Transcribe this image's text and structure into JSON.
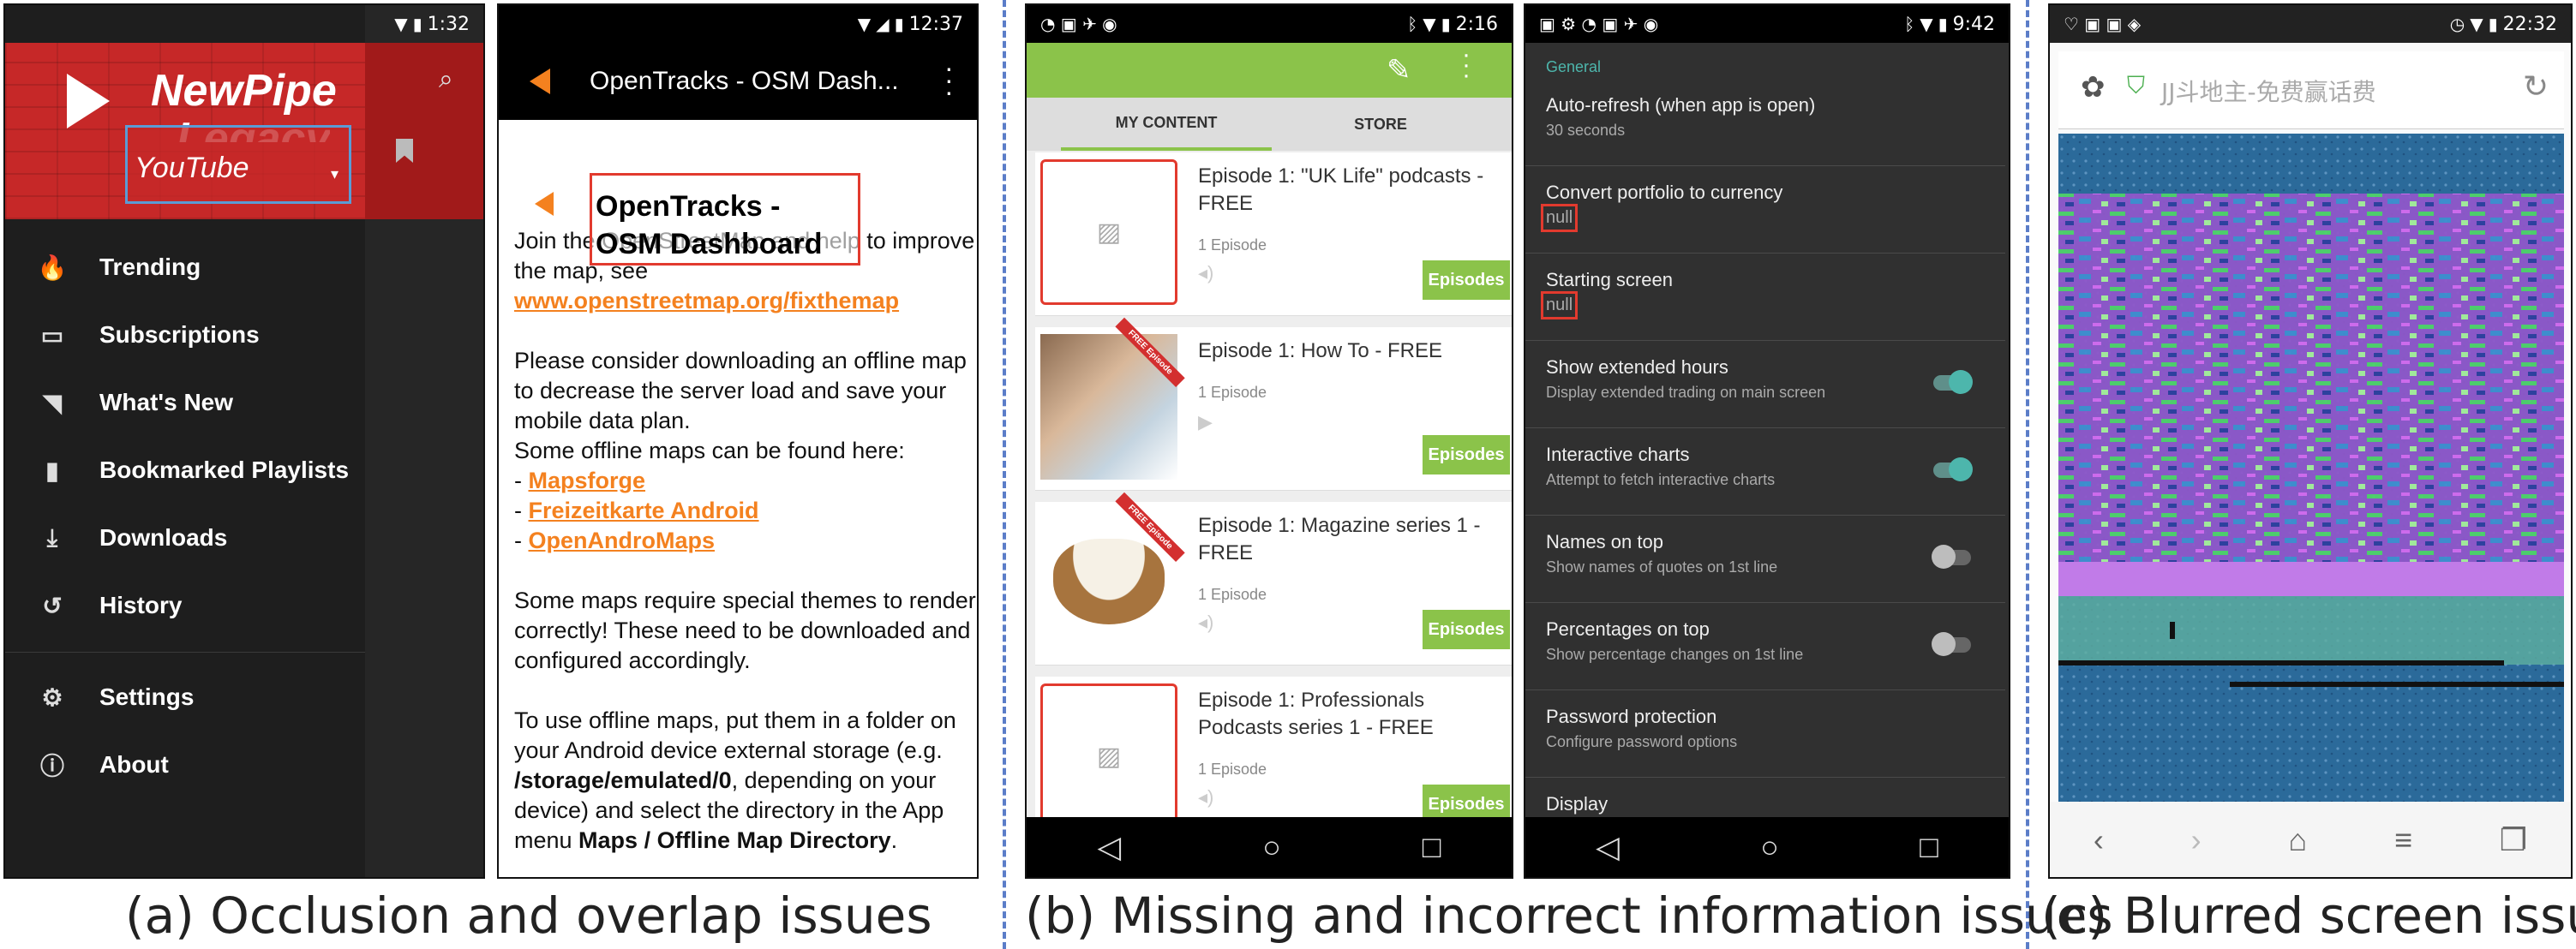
{
  "captions": {
    "a": "(a) Occlusion and overlap issues",
    "b": "(b) Missing and incorrect information issues",
    "c": "(c) Blurred screen issues"
  },
  "newpipe": {
    "time": "1:32",
    "app_name_line1": "NewPipe",
    "app_name_line2": "Legacy",
    "service": "YouTube",
    "menu": [
      {
        "icon": "fire-icon",
        "label": "Trending"
      },
      {
        "icon": "tv-icon",
        "label": "Subscriptions"
      },
      {
        "icon": "rss-icon",
        "label": "What's New"
      },
      {
        "icon": "bookmark-icon",
        "label": "Bookmarked Playlists"
      },
      {
        "icon": "download-icon",
        "label": "Downloads"
      },
      {
        "icon": "history-icon",
        "label": "History"
      },
      {
        "icon": "gear-icon",
        "label": "Settings"
      },
      {
        "icon": "info-icon",
        "label": "About"
      }
    ]
  },
  "opentracks": {
    "time": "12:37",
    "toolbar_title": "OpenTracks - OSM Dash...",
    "dialog_title": "OpenTracks - OSM Dashboard",
    "p1_prefix": "Join the OpenStreetMap and help to improve the map, see ",
    "p1_link": "www.openstreetmap.org/fixthemap",
    "p2": "Please consider downloading an offline map to decrease the server load and save your mobile data plan.",
    "p3": "Some offline maps can be found here:",
    "links": [
      "Mapsforge",
      "Freizeitkarte Android",
      "OpenAndroMaps"
    ],
    "p4": "Some maps require special themes to render correctly! These need to be downloaded and configured accordingly.",
    "p5_a": "To use offline maps, put them in a folder on your Android device external storage (e.g. ",
    "p5_b": "/storage/emulated/0",
    "p5_c": ", depending on your device) and select the directory in the App menu ",
    "p5_d": "Maps / Offline Map Directory",
    "p5_e": "."
  },
  "podcast": {
    "time": "2:16",
    "tabs": [
      "MY CONTENT",
      "STORE"
    ],
    "episodes_label": "Episodes",
    "items": [
      {
        "title": "Episode 1: \"UK Life\" podcasts - FREE",
        "count": "1 Episode",
        "media": "audio"
      },
      {
        "title": "Episode 1: How To - FREE",
        "count": "1 Episode",
        "media": "video"
      },
      {
        "title": "Episode 1: Magazine series 1 - FREE",
        "count": "1 Episode",
        "media": "audio"
      },
      {
        "title": "Episode 1: Professionals Podcasts series 1 - FREE",
        "count": "1 Episode",
        "media": "audio"
      }
    ],
    "ribbon": "FREE Episode"
  },
  "settings": {
    "time": "9:42",
    "section": "General",
    "rows": [
      {
        "title": "Auto-refresh (when app is open)",
        "sub": "30 seconds",
        "toggle": null
      },
      {
        "title": "Convert portfolio to currency",
        "sub": "null",
        "toggle": null
      },
      {
        "title": "Starting screen",
        "sub": "null",
        "toggle": null
      },
      {
        "title": "Show extended hours",
        "sub": "Display extended trading on main screen",
        "toggle": "on"
      },
      {
        "title": "Interactive charts",
        "sub": "Attempt to fetch interactive charts",
        "toggle": "on"
      },
      {
        "title": "Names on top",
        "sub": "Show names of quotes on 1st line",
        "toggle": "off"
      },
      {
        "title": "Percentages on top",
        "sub": "Show percentage changes on 1st line",
        "toggle": "off"
      },
      {
        "title": "Password protection",
        "sub": "Configure password options",
        "toggle": null
      },
      {
        "title": "Display",
        "sub": "",
        "toggle": null
      }
    ]
  },
  "browser": {
    "time": "22:32",
    "url_text": "JJ斗地主-免费赢话费"
  },
  "colors": {
    "newpipe_red": "#c62828",
    "podcast_green": "#8bc34a",
    "toggle_on": "#4db6ac",
    "link_orange": "#f4811f",
    "highlight_red": "#e23a2e"
  }
}
